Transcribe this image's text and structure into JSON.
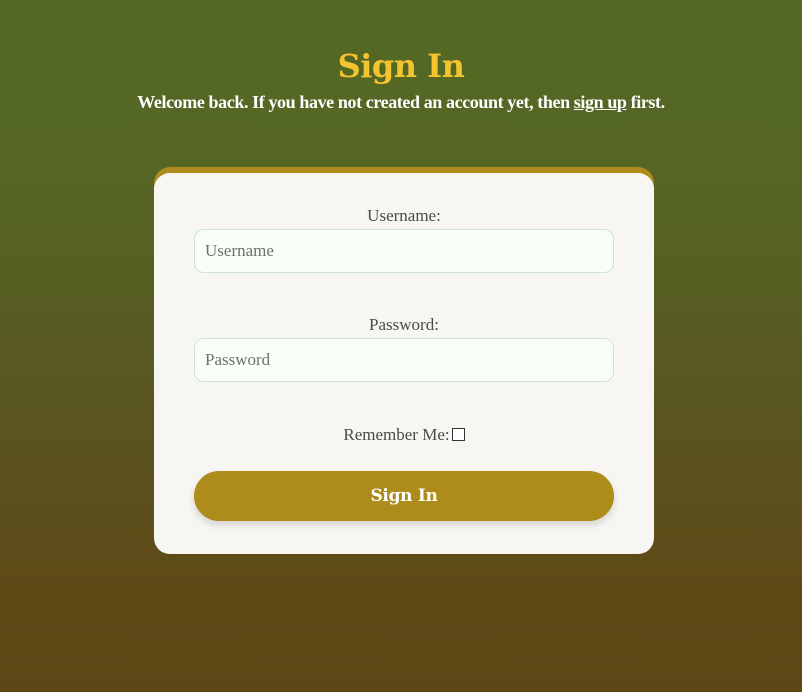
{
  "header": {
    "title": "Sign In",
    "subtitle_before": "Welcome back. If you have not created an account yet, then ",
    "subtitle_link": "sign up",
    "subtitle_after": " first."
  },
  "form": {
    "username_label": "Username:",
    "username_placeholder": "Username",
    "username_value": "",
    "password_label": "Password:",
    "password_placeholder": "Password",
    "password_value": "",
    "remember_label": "Remember Me:",
    "remember_checked": false,
    "submit_label": "Sign In"
  },
  "colors": {
    "title": "#f4c430",
    "accent": "#ad8c1c",
    "card": "#f7f6f2",
    "input_border": "#cfe3cf"
  }
}
